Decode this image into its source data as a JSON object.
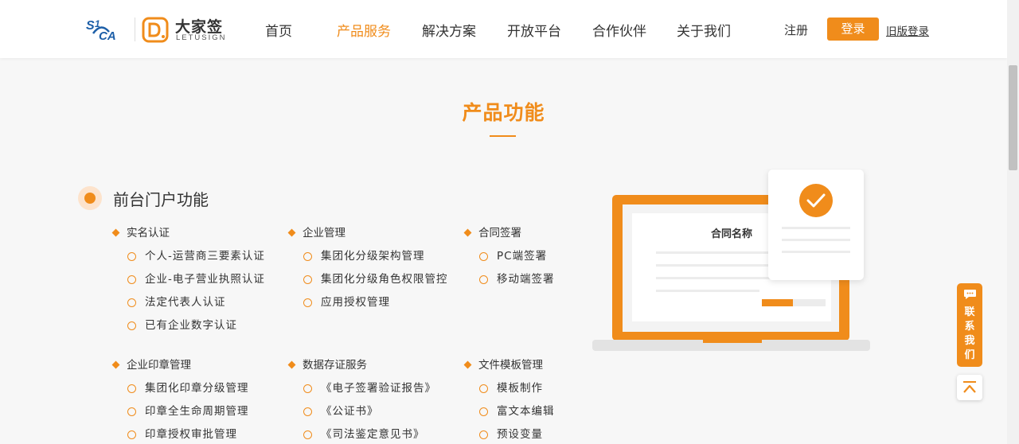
{
  "header": {
    "brand_name": "大家签",
    "brand_sub": "LETUSIGN",
    "nav": [
      {
        "label": "首页",
        "active": false
      },
      {
        "label": "产品服务",
        "active": true
      },
      {
        "label": "解决方案",
        "active": false
      },
      {
        "label": "开放平台",
        "active": false
      },
      {
        "label": "合作伙伴",
        "active": false
      },
      {
        "label": "关于我们",
        "active": false
      }
    ],
    "register_label": "注册",
    "login_label": "登录",
    "old_login_label": "旧版登录"
  },
  "section": {
    "title": "产品功能",
    "subtitle": "前台门户功能"
  },
  "groups": [
    {
      "title": "实名认证",
      "items": [
        "个人-运营商三要素认证",
        "企业-电子营业执照认证",
        "法定代表人认证",
        "已有企业数字认证"
      ]
    },
    {
      "title": "企业管理",
      "items": [
        "集团化分级架构管理",
        "集团化分级角色权限管控",
        "应用授权管理"
      ]
    },
    {
      "title": "合同签署",
      "items": [
        "PC端签署",
        "移动端签署"
      ]
    },
    {
      "title": "企业印章管理",
      "items": [
        "集团化印章分级管理",
        "印章全生命周期管理",
        "印章授权审批管理"
      ]
    },
    {
      "title": "数据存证服务",
      "items": [
        "《电子签署验证报告》",
        "《公证书》",
        "《司法鉴定意见书》"
      ]
    },
    {
      "title": "文件模板管理",
      "items": [
        "模板制作",
        "富文本编辑",
        "预设变量"
      ]
    }
  ],
  "illustration": {
    "doc_title": "合同名称"
  },
  "float": {
    "contact_chars": [
      "联",
      "系",
      "我",
      "们"
    ]
  },
  "colors": {
    "accent": "#f08c1b",
    "accent_light": "#fde3cc"
  },
  "icons": {
    "contact": "chat-bubble-icon",
    "to_top": "arrow-up-bar-icon",
    "check": "check-icon"
  }
}
